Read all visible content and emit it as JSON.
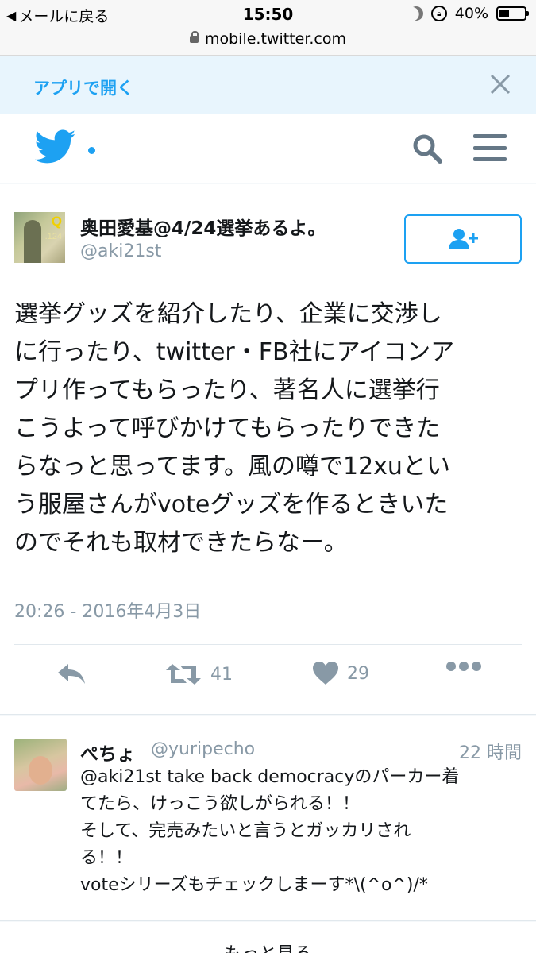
{
  "status_bar": {
    "back_label": "メールに戻る",
    "time": "15:50",
    "battery": "40%",
    "battery_level": 0.4,
    "url": "mobile.twitter.com"
  },
  "app_banner": {
    "open_label": "アプリで開く",
    "close_symbol": "✕"
  },
  "tweet": {
    "author_name": "奥田愛基@4/24選挙あるよ。",
    "author_handle": "@aki21st",
    "avatar_text": "Q",
    "avatar_num": ".124",
    "text_lines": [
      "選挙グッズを紹介したり、企業に交渉し",
      "に行ったり、twitter・FB社にアイコンア",
      "プリ作ってもらったり、著名人に選挙行",
      "こうよって呼びかけてもらったりできた",
      "らなっと思ってます。風の噂で12xuとい",
      "う服屋さんがvoteグッズを作るときいた",
      "のでそれも取材できたらなー。"
    ],
    "timestamp": "20:26 - 2016年4月3日",
    "retweet_count": "41",
    "like_count": "29"
  },
  "reply": {
    "name": "ぺちょ",
    "handle": "@yuripecho",
    "time": "22 時間",
    "text_lines": [
      "@aki21st take back democracyのパーカー着",
      "てたら、けっこう欲しがられる！！",
      "そして、完売みたいと言うとガッカリされ",
      "る！！",
      "voteシリーズもチェックしまーす*\\(^o^)/*"
    ]
  },
  "more_label": "もっと見る",
  "colors": {
    "accent": "#1da1f2",
    "muted": "#8899a6",
    "banner_bg": "#e8f5fd"
  }
}
